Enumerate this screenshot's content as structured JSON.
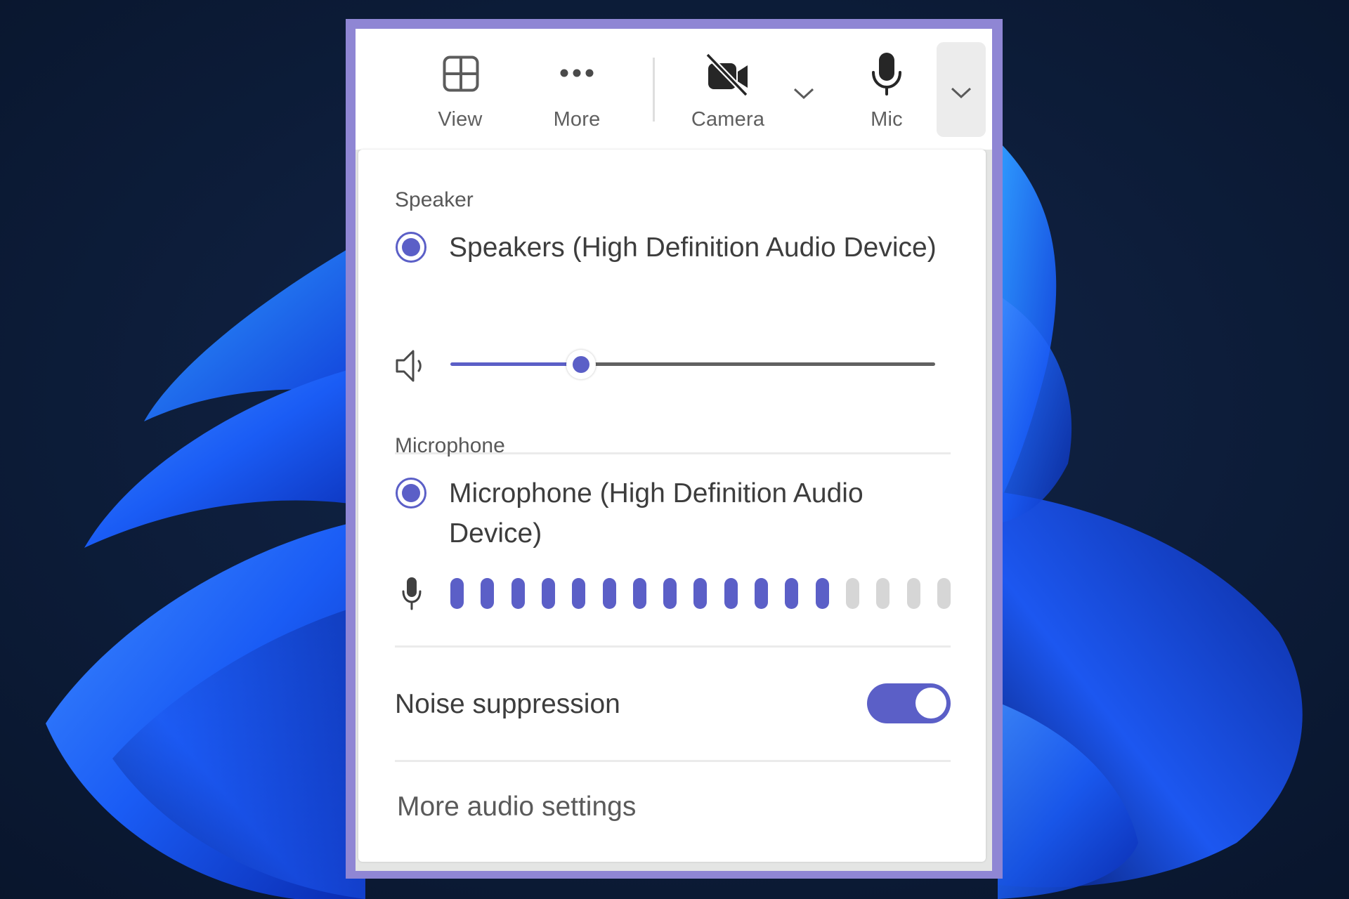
{
  "toolbar": {
    "buttons": [
      {
        "id": "view",
        "label": "View",
        "icon": "grid-icon"
      },
      {
        "id": "more",
        "label": "More",
        "icon": "more-dots-icon"
      },
      {
        "id": "camera",
        "label": "Camera",
        "icon": "camera-off-icon",
        "state": "off"
      },
      {
        "id": "mic",
        "label": "Mic",
        "icon": "microphone-icon",
        "state": "on"
      }
    ],
    "camera_options_icon": "chevron-down-icon",
    "mic_options_icon": "chevron-down-icon"
  },
  "audio_menu": {
    "speaker": {
      "section_label": "Speaker",
      "selected_device": "Speakers (High Definition Audio Device)",
      "volume_icon": "speaker-volume-icon",
      "volume_percent": 27
    },
    "microphone": {
      "section_label": "Microphone",
      "selected_device": "Microphone (High Definition Audio Device)",
      "level_icon": "microphone-icon",
      "level_segments_total": 17,
      "level_segments_active": 13
    },
    "noise_suppression": {
      "label": "Noise suppression",
      "enabled": true
    },
    "more_settings_label": "More audio settings"
  },
  "colors": {
    "accent": "#5b5fc7",
    "frame": "#8f86d4",
    "meter_inactive": "#d6d6d6",
    "track_inactive": "#616161"
  }
}
